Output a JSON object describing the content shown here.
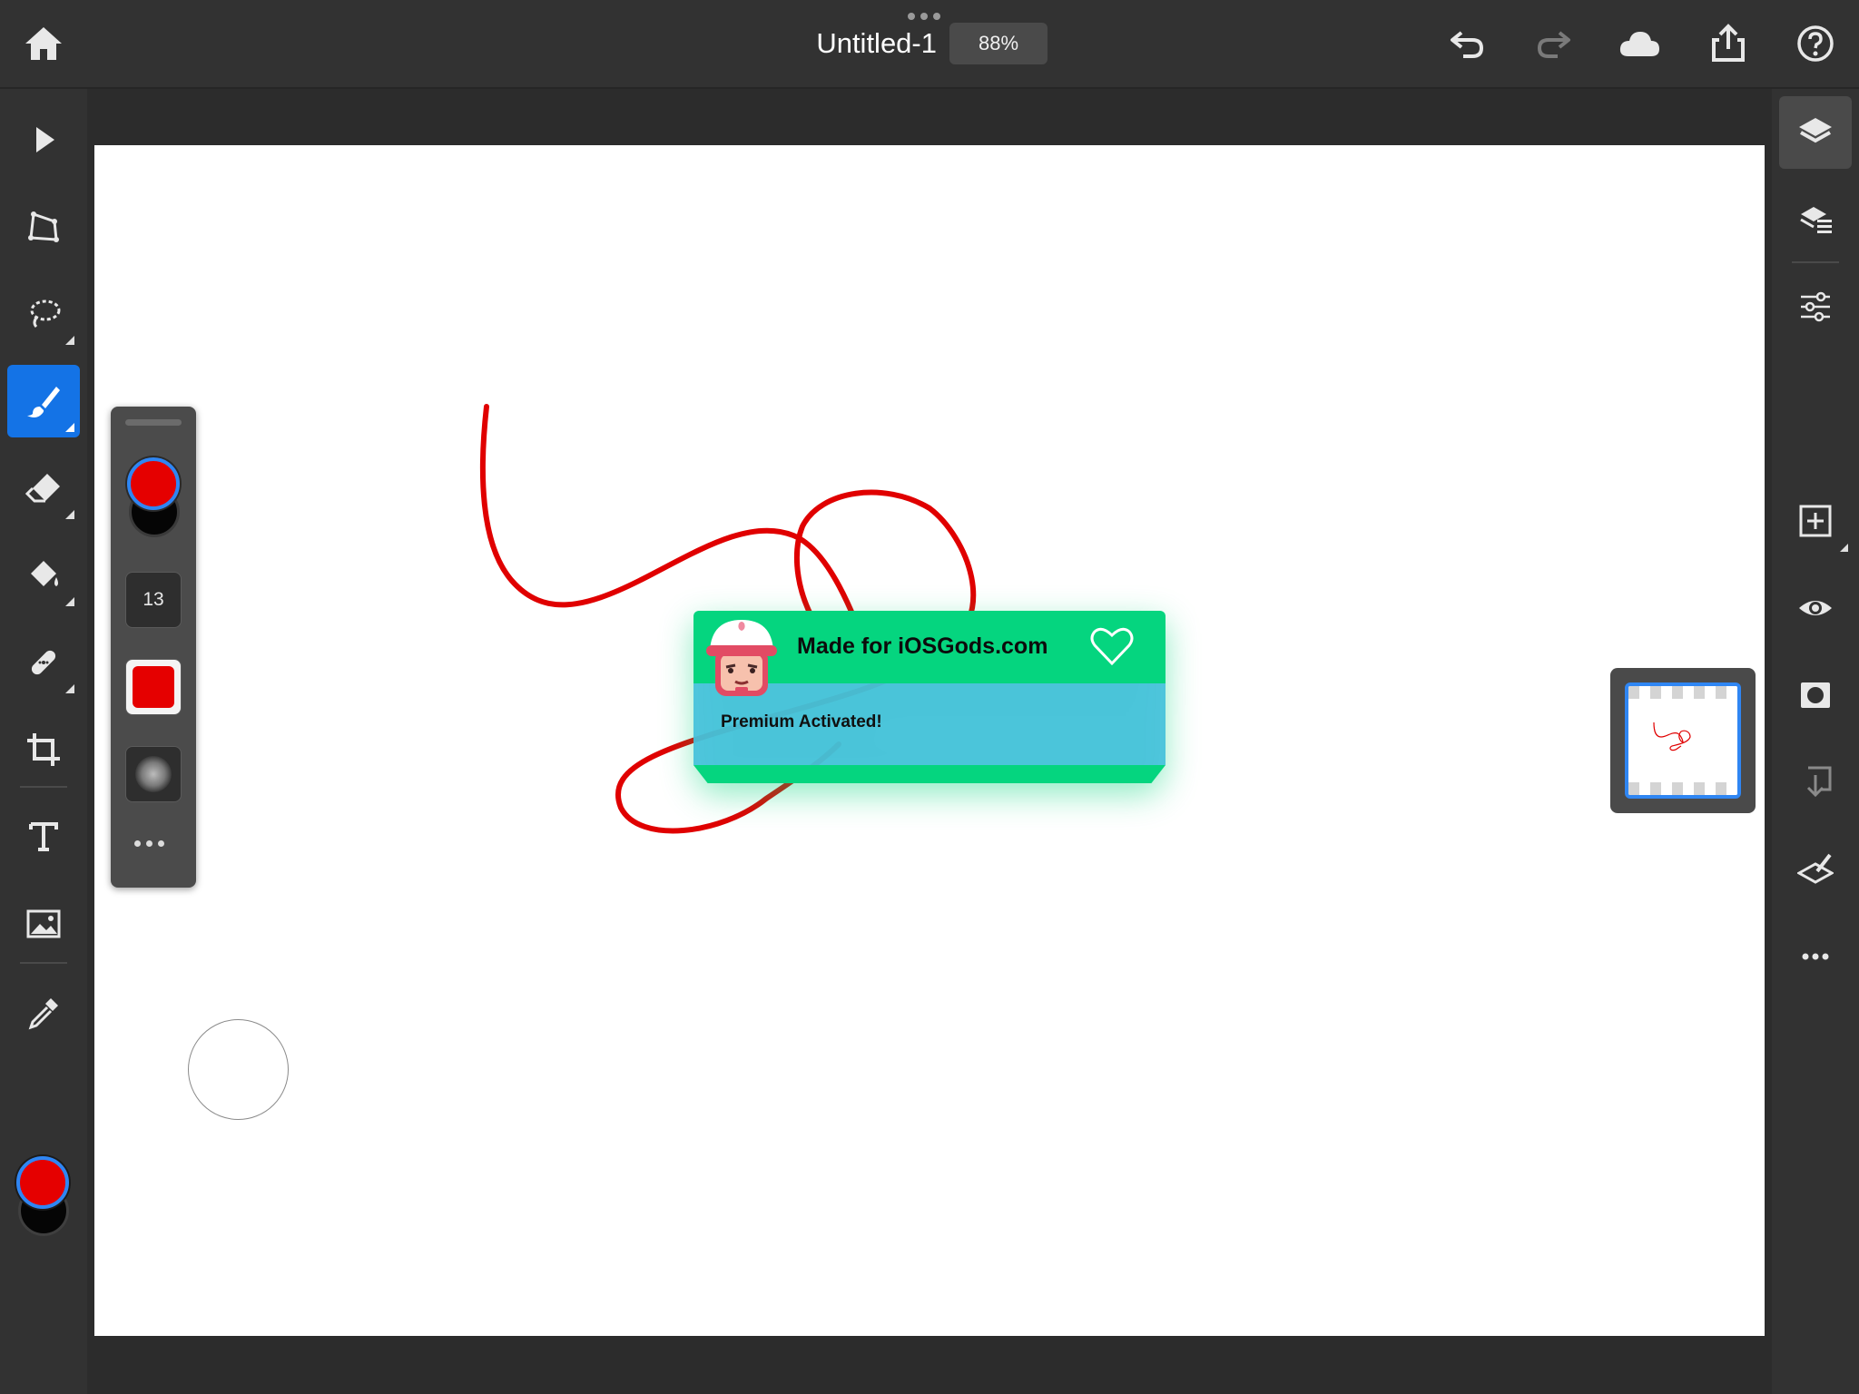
{
  "document": {
    "title": "Untitled-1",
    "zoom": "88%"
  },
  "brush_panel": {
    "size": "13"
  },
  "toast": {
    "title": "Made for iOSGods.com",
    "message": "Premium Activated!"
  },
  "colors": {
    "accent": "#1473e6",
    "foreground_swatch": "#e50000",
    "background_swatch": "#000000",
    "stroke": "#e00000",
    "toast_green": "#05d57f",
    "toast_blue": "#45c2db"
  },
  "top_toolbar_icons": [
    "home-icon",
    "undo-icon",
    "redo-icon",
    "cloud-icon",
    "share-icon",
    "help-icon"
  ],
  "left_tools": [
    "select-icon",
    "transform-icon",
    "lasso-icon",
    "brush-icon",
    "eraser-icon",
    "fill-icon",
    "heal-icon",
    "crop-icon",
    "text-icon",
    "image-icon",
    "eyedropper-icon"
  ],
  "right_tools": [
    "layers-icon",
    "layer-properties-icon",
    "adjustments-icon",
    "add-layer-icon",
    "visibility-icon",
    "mask-icon",
    "merge-down-icon",
    "clear-layer-icon",
    "more-icon"
  ]
}
